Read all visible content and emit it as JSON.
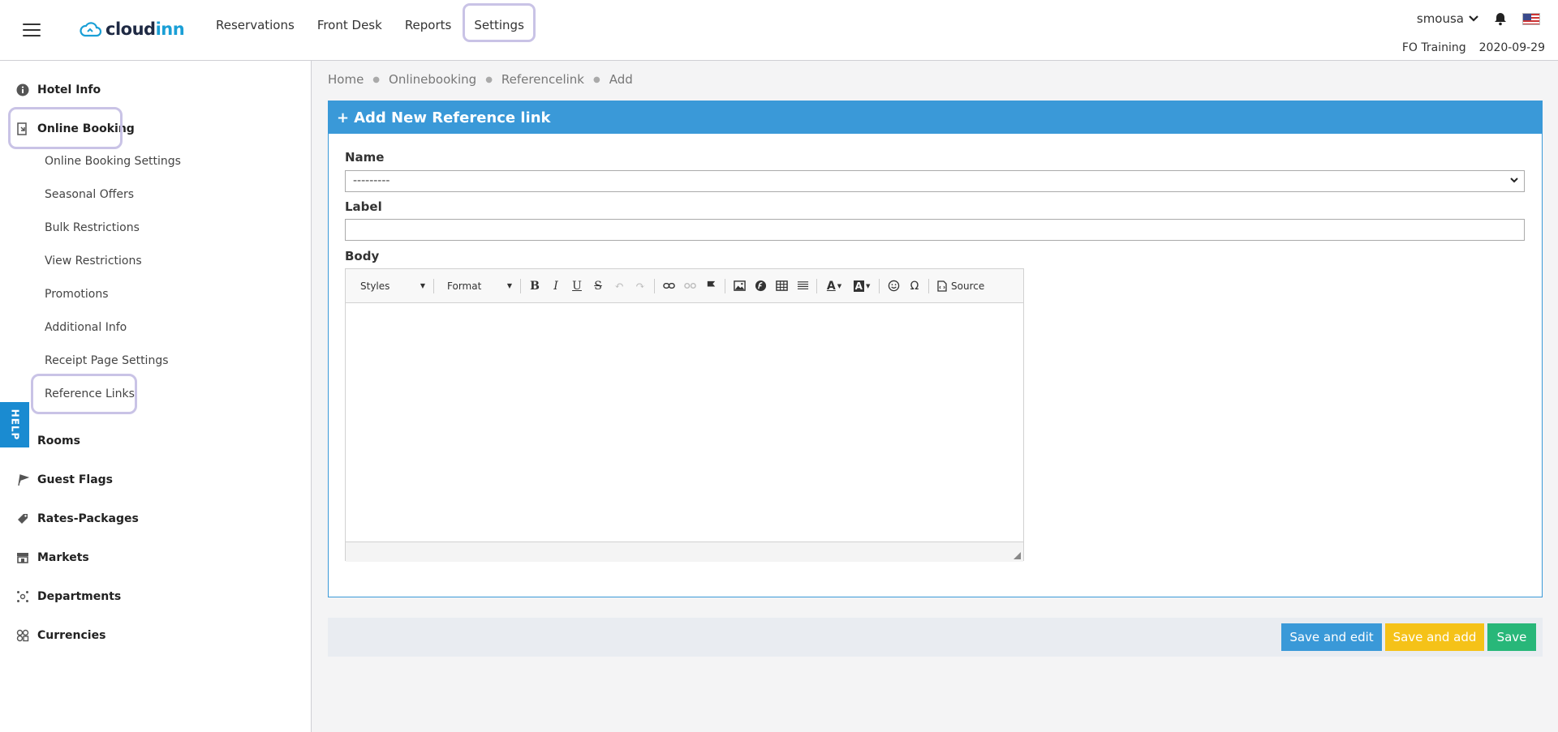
{
  "brand": {
    "name_part1": "cloud",
    "name_part2": "inn"
  },
  "topnav": [
    {
      "label": "Reservations"
    },
    {
      "label": "Front Desk"
    },
    {
      "label": "Reports"
    },
    {
      "label": "Settings"
    }
  ],
  "user": {
    "name": "smousa",
    "property": "FO Training",
    "date": "2020-09-29"
  },
  "sidebar": {
    "items": [
      {
        "label": "Hotel Info",
        "icon": "info-icon"
      },
      {
        "label": "Online Booking",
        "icon": "booking-icon"
      },
      {
        "label": "Rooms",
        "icon": "room-icon"
      },
      {
        "label": "Guest Flags",
        "icon": "flag-icon"
      },
      {
        "label": "Rates-Packages",
        "icon": "tag-icon"
      },
      {
        "label": "Markets",
        "icon": "store-icon"
      },
      {
        "label": "Departments",
        "icon": "departments-icon"
      },
      {
        "label": "Currencies",
        "icon": "currency-icon"
      }
    ],
    "sub_items": [
      {
        "label": "Online Booking Settings"
      },
      {
        "label": "Seasonal Offers"
      },
      {
        "label": "Bulk Restrictions"
      },
      {
        "label": "View Restrictions"
      },
      {
        "label": "Promotions"
      },
      {
        "label": "Additional Info"
      },
      {
        "label": "Receipt Page Settings"
      },
      {
        "label": "Reference Links"
      }
    ],
    "help_label": "HELP"
  },
  "breadcrumb": [
    "Home",
    "Onlinebooking",
    "Referencelink",
    "Add"
  ],
  "form": {
    "title": "Add New Reference link",
    "name_label": "Name",
    "name_value": "---------",
    "label_label": "Label",
    "label_value": "",
    "body_label": "Body",
    "editor": {
      "styles_label": "Styles",
      "format_label": "Format",
      "source_label": "Source"
    }
  },
  "actions": {
    "save_edit": "Save and edit",
    "save_add": "Save and add",
    "save": "Save"
  },
  "colors": {
    "primary": "#3a99d8",
    "warning": "#f5c218",
    "success": "#28b779",
    "highlight": "#c9c3e6"
  }
}
